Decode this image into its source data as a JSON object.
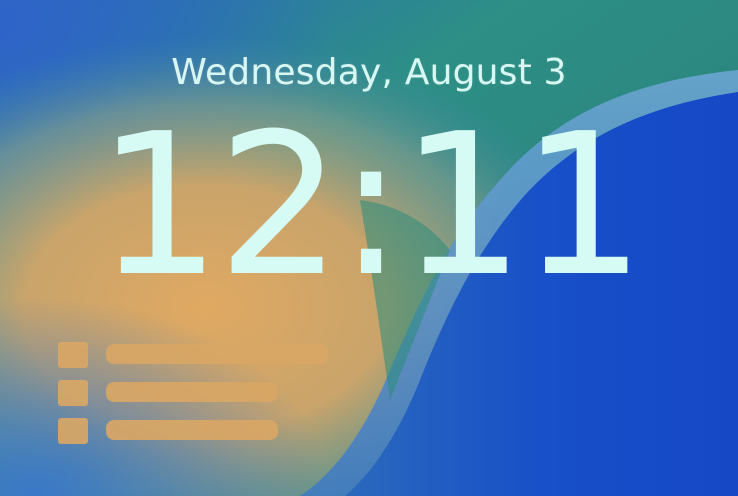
{
  "lock_screen": {
    "date": "Wednesday, August 3",
    "time": "12:11"
  },
  "icons": {
    "list_widget": "list-icon"
  },
  "colors": {
    "clock_text": "#d6fbf4",
    "wallpaper_teal": "#2a8a7c",
    "wallpaper_blue": "#1a4fc4",
    "wallpaper_orange": "#d6a866",
    "widget_tint": "#d9a765"
  }
}
